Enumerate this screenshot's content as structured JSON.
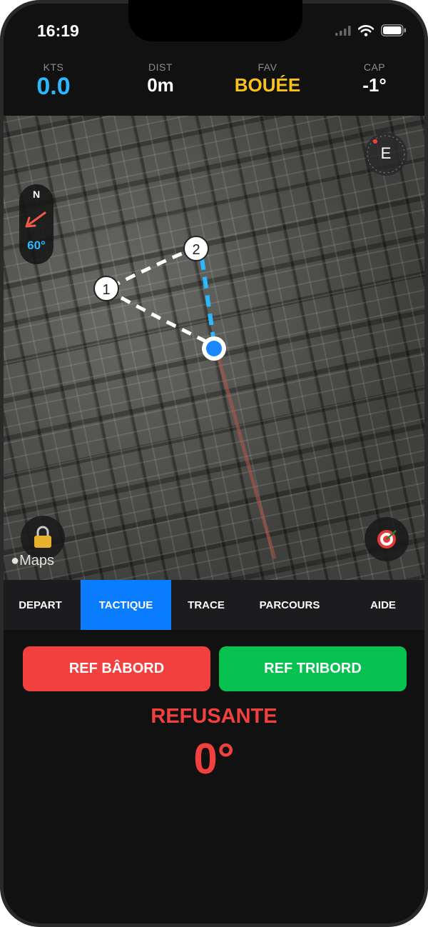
{
  "status": {
    "time": "16:19",
    "icons": [
      "signal-icon",
      "wifi-icon",
      "battery-icon"
    ]
  },
  "metrics": [
    {
      "label": "KTS",
      "value": "0.0"
    },
    {
      "label": "DIST",
      "value": "0m"
    },
    {
      "label": "FAV",
      "value": "BOUÉE"
    },
    {
      "label": "CAP",
      "value": "-1°"
    }
  ],
  "map": {
    "compass_north_label": "N",
    "wind_angle": "60°",
    "compass_east_label": "E",
    "waypoints": [
      "1",
      "2"
    ],
    "attribution": "Maps",
    "icons": {
      "wind_arrow": "arrow-icon",
      "lock": "lock-icon",
      "target": "target-icon",
      "location": "location-dot-icon"
    }
  },
  "tabs": [
    {
      "label": "DEPART",
      "active": false
    },
    {
      "label": "TACTIQUE",
      "active": true
    },
    {
      "label": "TRACE",
      "active": false
    },
    {
      "label": "PARCOURS",
      "active": false
    },
    {
      "label": "AIDE",
      "active": false
    }
  ],
  "actions": {
    "port_label": "REF BÂBORD",
    "starboard_label": "REF TRIBORD"
  },
  "refusante": {
    "label": "REFUSANTE",
    "value": "0°"
  },
  "colors": {
    "accent_blue": "#0A7CFF",
    "speed_blue": "#2BB8FF",
    "fav_yellow": "#F7C21A",
    "port_red": "#F2403F",
    "starboard_green": "#06C050"
  }
}
